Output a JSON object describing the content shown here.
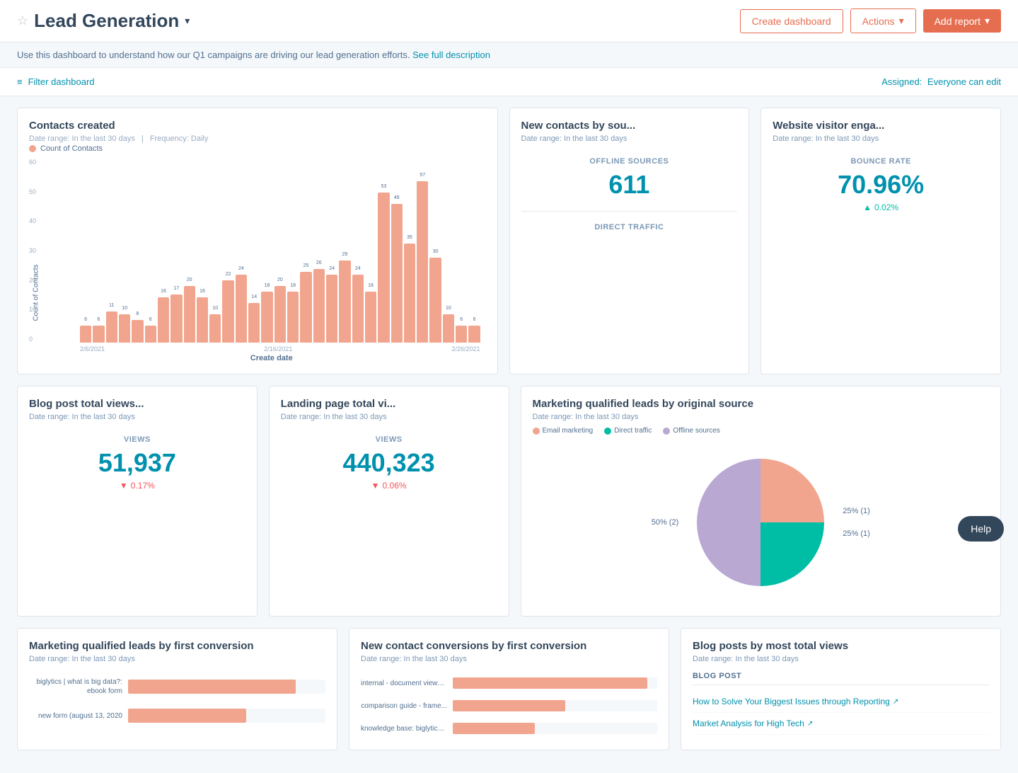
{
  "header": {
    "title": "Lead Generation",
    "star_label": "☆",
    "chevron": "▾",
    "create_dashboard_label": "Create dashboard",
    "actions_label": "Actions",
    "actions_chevron": "▾",
    "add_report_label": "Add report",
    "add_report_chevron": "▾"
  },
  "description": {
    "text": "Use this dashboard to understand how our Q1 campaigns are driving our lead generation efforts.",
    "link_text": "See full description"
  },
  "filter_bar": {
    "filter_label": "Filter dashboard",
    "filter_icon": "≡",
    "assigned_label": "Assigned:",
    "assigned_value": "Everyone can edit"
  },
  "contacts_created": {
    "title": "Contacts created",
    "date_range": "Date range: In the last 30 days",
    "separator": "|",
    "frequency": "Frequency: Daily",
    "legend": "Count of Contacts",
    "x_axis_label": "Create date",
    "y_axis_label": "Count of Contacts",
    "bars": [
      6,
      6,
      11,
      10,
      8,
      6,
      16,
      17,
      20,
      16,
      10,
      22,
      24,
      14,
      18,
      20,
      18,
      25,
      26,
      24,
      29,
      24,
      18,
      53,
      49,
      35,
      57,
      30,
      10,
      6,
      6
    ],
    "x_labels": [
      "2/6/2021",
      "2/16/2021",
      "2/26/2021"
    ],
    "y_labels": [
      60,
      50,
      40,
      30,
      20,
      10,
      0
    ],
    "color": "#f2a58e"
  },
  "new_contacts_by_source": {
    "title": "New contacts by sou...",
    "date_range": "Date range: In the last 30 days",
    "offline_label": "OFFLINE SOURCES",
    "offline_value": "611",
    "direct_label": "DIRECT TRAFFIC",
    "direct_value": ""
  },
  "website_visitor": {
    "title": "Website visitor enga...",
    "date_range": "Date range: In the last 30 days",
    "bounce_label": "BOUNCE RATE",
    "bounce_value": "70.96%",
    "bounce_change": "0.02%",
    "bounce_up": true
  },
  "mql_by_source": {
    "title": "Marketing qualified leads by original source",
    "date_range": "Date range: In the last 30 days",
    "legend": [
      {
        "label": "Email marketing",
        "color": "#f2a58e"
      },
      {
        "label": "Direct traffic",
        "color": "#00bda5"
      },
      {
        "label": "Offline sources",
        "color": "#b9a8d2"
      }
    ],
    "segments": [
      {
        "label": "50% (2)",
        "percent": 50,
        "color": "#b9a8d2"
      },
      {
        "label": "25% (1)",
        "percent": 25,
        "color": "#f2a58e"
      },
      {
        "label": "25% (1)",
        "percent": 25,
        "color": "#00bda5"
      }
    ]
  },
  "blog_post_views": {
    "title": "Blog post total views...",
    "date_range": "Date range: In the last 30 days",
    "views_label": "VIEWS",
    "views_value": "51,937",
    "change": "0.17%",
    "change_down": true
  },
  "landing_page_views": {
    "title": "Landing page total vi...",
    "date_range": "Date range: In the last 30 days",
    "views_label": "VIEWS",
    "views_value": "440,323",
    "change": "0.06%",
    "change_down": true
  },
  "mql_first_conversion": {
    "title": "Marketing qualified leads by first conversion",
    "date_range": "Date range: In the last 30 days",
    "bars": [
      {
        "label": "biglytics | what is big data?:\nebook form",
        "value": 85
      },
      {
        "label": "new form (august 13, 2020",
        "value": 60
      }
    ]
  },
  "new_contact_conversions": {
    "title": "New contact conversions by first conversion",
    "date_range": "Date range: In the last 30 days",
    "bars": [
      {
        "label": "internal - document viewer...",
        "value": 95
      },
      {
        "label": "comparison guide - frame...",
        "value": 55
      },
      {
        "label": "knowledge base: biglytics ...",
        "value": 40
      }
    ]
  },
  "blog_posts_views": {
    "title": "Blog posts by most total views",
    "date_range": "Date range: In the last 30 days",
    "col_label": "BLOG POST",
    "links": [
      {
        "text": "How to Solve Your Biggest Issues through Reporting"
      },
      {
        "text": "Market Analysis for High Tech"
      }
    ]
  },
  "help": {
    "label": "Help"
  }
}
